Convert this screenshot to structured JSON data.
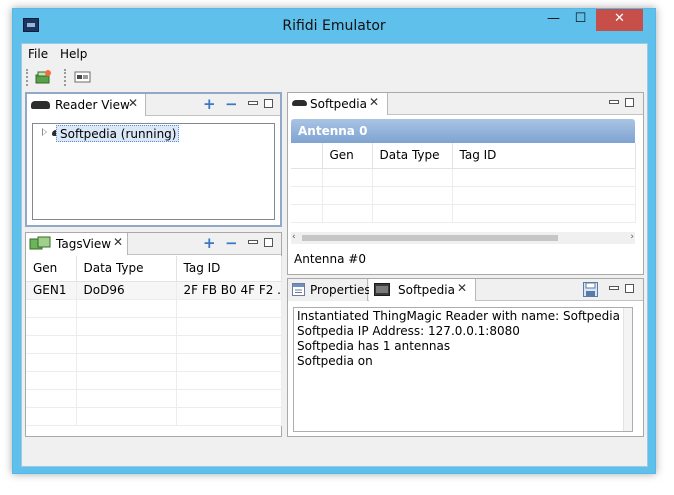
{
  "window": {
    "title": "Rifidi Emulator",
    "minimize_glyph": "—",
    "maximize_glyph": "☐",
    "close_glyph": "✕"
  },
  "menu": {
    "items": [
      "File",
      "Help"
    ]
  },
  "toolbar": {
    "icons": [
      "add-reader-icon",
      "layout-icon"
    ]
  },
  "reader_view": {
    "tab_label": "Reader View",
    "close_glyph": "✕",
    "add_glyph": "+",
    "remove_glyph": "−",
    "tree": [
      {
        "label": "Softpedia (running)",
        "icon": "reader-icon"
      }
    ]
  },
  "tags_view": {
    "tab_label": "TagsView",
    "close_glyph": "✕",
    "add_glyph": "+",
    "remove_glyph": "−",
    "columns": [
      "Gen",
      "Data Type",
      "Tag ID"
    ],
    "rows": [
      [
        "GEN1",
        "DoD96",
        "2F FB B0 4F F2 ..."
      ]
    ]
  },
  "softpedia_editor": {
    "tab_label": "Softpedia",
    "close_glyph": "✕",
    "antenna_header": "Antenna 0",
    "columns": [
      "",
      "Gen",
      "Data Type",
      "Tag ID"
    ],
    "bottom_tab": "Antenna #0"
  },
  "bottom_panel": {
    "tabs": [
      "Properties",
      "Softpedia"
    ],
    "close_glyph": "✕",
    "console_lines": [
      "Instantiated ThingMagic Reader with name: Softpedia",
      "Softpedia IP Address: 127.0.0.1:8080",
      "Softpedia has 1 antennas",
      "Softpedia on"
    ]
  },
  "colors": {
    "title_bar": "#5fc0ec",
    "close_button": "#c74f4a",
    "antenna_banner": "#8fb0da",
    "selection": "#dbe8f8"
  }
}
